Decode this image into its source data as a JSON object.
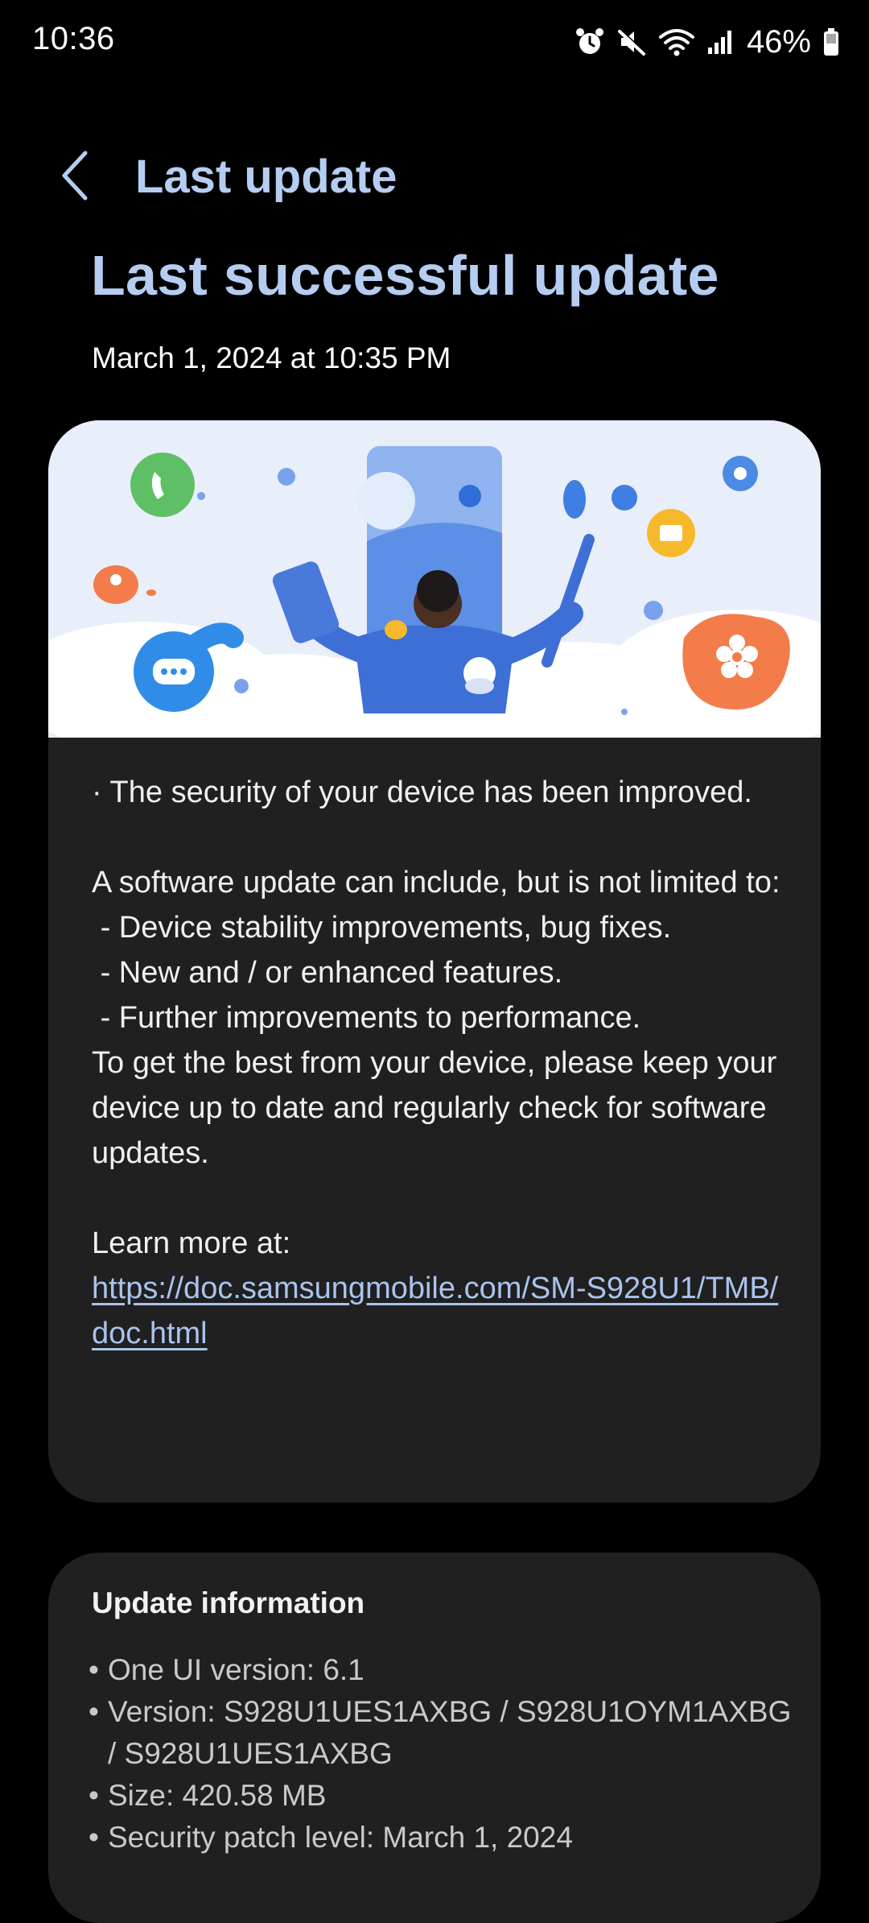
{
  "status_bar": {
    "time": "10:36",
    "battery": "46%",
    "icons": [
      "alarm-icon",
      "mute-icon",
      "wifi-icon",
      "signal-icon",
      "battery-icon"
    ]
  },
  "header": {
    "back_icon": "chevron-left-icon",
    "title": "Last update"
  },
  "page": {
    "title": "Last successful update",
    "date": "March 1, 2024 at 10:35 PM"
  },
  "main_card": {
    "illustration": "software-update-illustration",
    "body_lines": [
      "· The security of your device has been improved.",
      "",
      "A software update can include, but is not limited to:",
      " - Device stability improvements, bug fixes.",
      " - New and / or enhanced features.",
      " - Further improvements to performance.",
      "To get the best from your device, please keep your device up to date and regularly check for software updates.",
      "",
      "Learn more at:"
    ],
    "link": "https://doc.samsungmobile.com/SM-S928U1/TMB/doc.html"
  },
  "info_card": {
    "title": "Update information",
    "items": [
      "One UI version: 6.1",
      "Version: S928U1UES1AXBG / S928U1OYM1AXBG / S928U1UES1AXBG",
      "Size: 420.58 MB",
      "Security patch level: March 1, 2024"
    ]
  },
  "colors": {
    "background": "#000000",
    "accent_title": "#b6cdf2",
    "card": "#202020",
    "link": "#a9c3ee"
  }
}
